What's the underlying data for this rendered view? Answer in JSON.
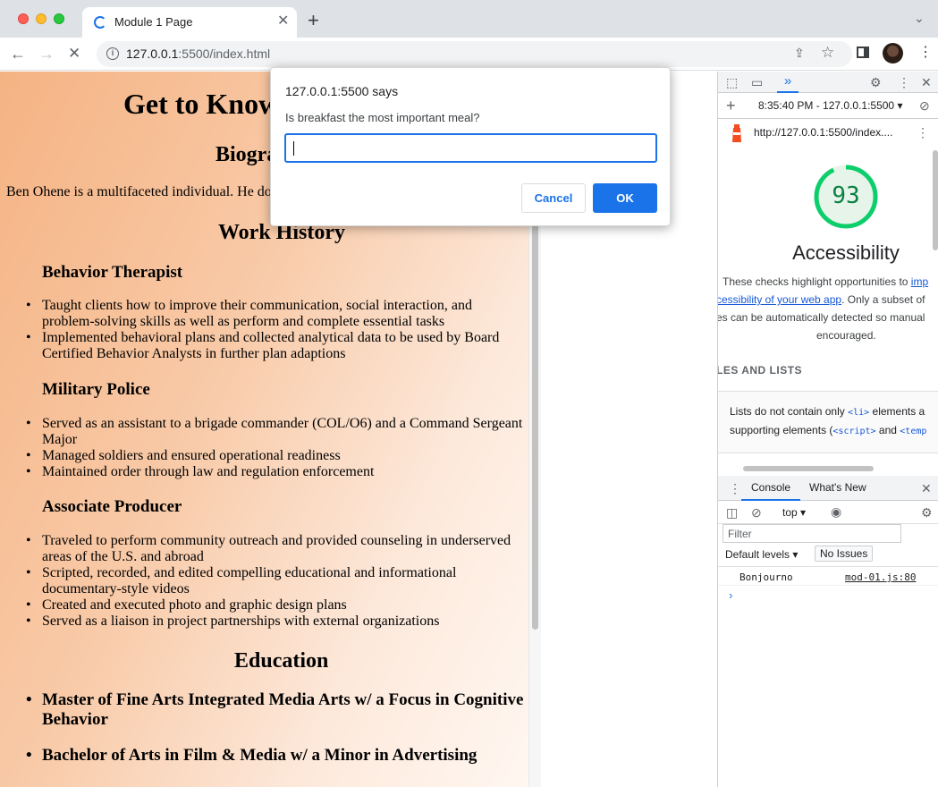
{
  "browser": {
    "tab_title": "Module 1 Page",
    "url_host": "127.0.0.1",
    "url_rest": ":5500/index.html"
  },
  "page": {
    "title": "Get to Know",
    "bio_heading": "Biogra",
    "bio_text": "Ben Ohene is a multifaceted individual. He do",
    "work_heading": "Work History",
    "jobs": [
      {
        "title": "Behavior Therapist",
        "items": [
          "Taught clients how to improve their communication, social interaction, and problem-solving skills as well as perform and complete essential tasks",
          "Implemented behavioral plans and collected analytical data to be used by Board Certified Behavior Analysts in further plan adaptions"
        ]
      },
      {
        "title": "Military Police",
        "items": [
          "Served as an assistant to a brigade commander (COL/O6) and a Command Sergeant Major",
          "Managed soldiers and ensured operational readiness",
          "Maintained order through law and regulation enforcement"
        ]
      },
      {
        "title": "Associate Producer",
        "items": [
          "Traveled to perform community outreach and provided counseling in underserved areas of the U.S. and abroad",
          "Scripted, recorded, and edited compelling educational and informational documentary-style videos",
          "Created and executed photo and graphic design plans",
          "Served as a liaison in project partnerships with external organizations"
        ]
      }
    ],
    "education_heading": "Education",
    "education": [
      "Master of Fine Arts Integrated Media Arts w/ a Focus in Cognitive Behavior",
      "Bachelor of Arts in Film & Media w/ a Minor in Advertising"
    ]
  },
  "dialog": {
    "title": "127.0.0.1:5500 says",
    "message": "Is breakfast the most important meal?",
    "input_value": "",
    "cancel_label": "Cancel",
    "ok_label": "OK"
  },
  "devtools": {
    "lighthouse": {
      "report_time": "8:35:40 PM - 127.0.0.1:5500",
      "report_url": "http://127.0.0.1:5500/index....",
      "score": "93",
      "category": "Accessibility",
      "desc_1a": "These checks highlight opportunities to ",
      "desc_1b": "imp",
      "desc_2a": "cessibility of your web app",
      "desc_2b": ". Only a subset of",
      "desc_3": "es can be automatically detected so manual",
      "desc_4": "encouraged.",
      "section": "LES AND LISTS",
      "audit_1a": "Lists do not contain only ",
      "audit_1b": "<li>",
      "audit_1c": " elements a",
      "audit_2a": "supporting elements (",
      "audit_2b": "<script>",
      "audit_2c": " and ",
      "audit_2d": "<temp"
    },
    "console": {
      "tab_console": "Console",
      "tab_whats_new": "What's New",
      "context": "top",
      "filter_placeholder": "Filter",
      "levels": "Default levels",
      "issues": "No Issues",
      "log_message": "Bonjourno",
      "log_source": "mod-01.js:80"
    }
  },
  "colors": {
    "accent": "#1a73e8",
    "score_green": "#0b8043"
  }
}
